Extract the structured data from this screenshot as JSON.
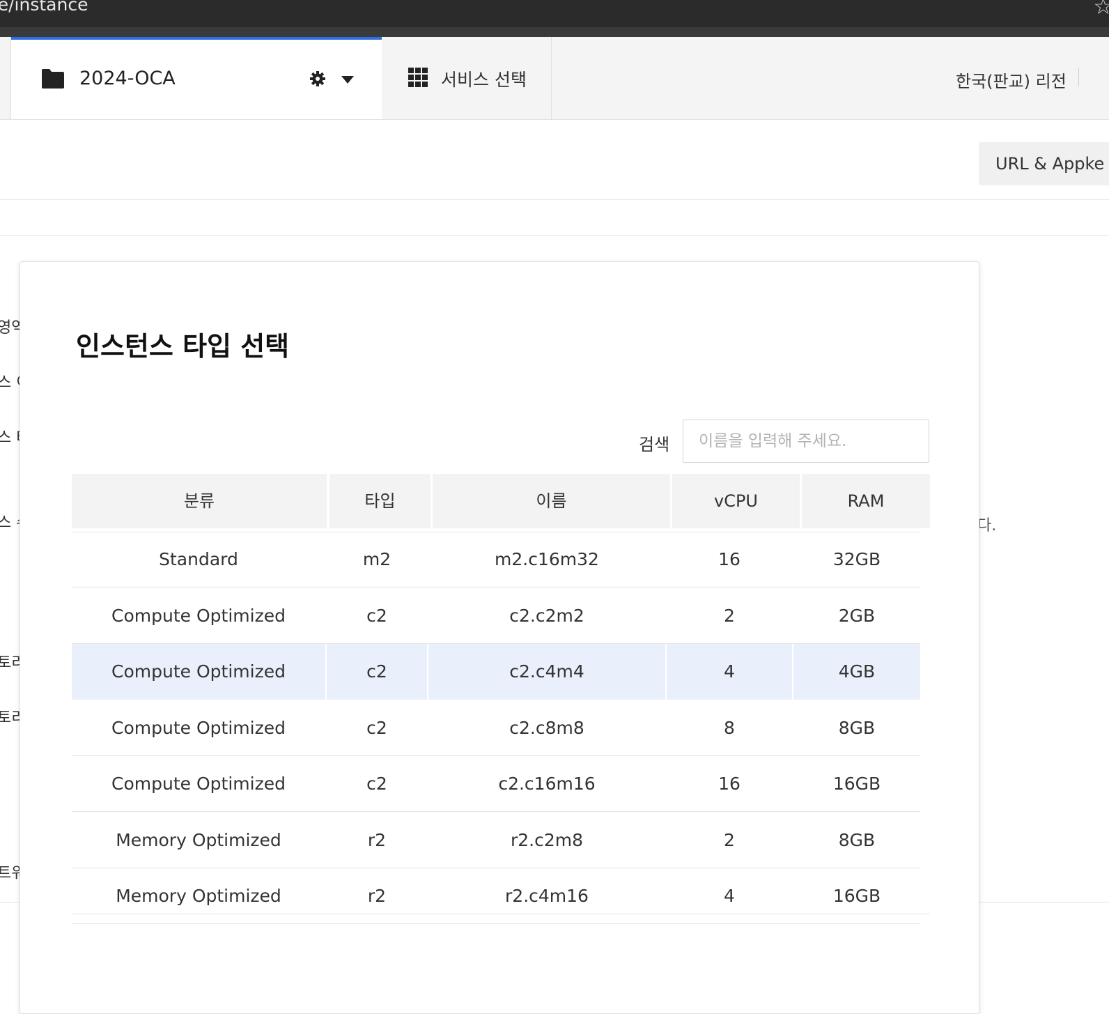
{
  "browser": {
    "url_fragment": "ite/instance"
  },
  "header": {
    "project_name": "2024-OCA",
    "service_select_label": "서비스 선택",
    "region_label": "한국(판교) 리전"
  },
  "toolbar": {
    "url_appkey_label": "URL & Appke"
  },
  "background": {
    "left_fragments": [
      "영역",
      "스 이",
      "스 타",
      "스 수",
      "토리",
      "토리",
      "트워"
    ],
    "right_fragment": "다."
  },
  "modal": {
    "title": "인스턴스 타입 선택",
    "search": {
      "label": "검색",
      "placeholder": "이름을 입력해 주세요."
    },
    "columns": [
      "분류",
      "타입",
      "이름",
      "vCPU",
      "RAM"
    ],
    "rows": [
      {
        "category": "Standard",
        "type": "m2",
        "name": "m2.c16m32",
        "vcpu": "16",
        "ram": "32GB"
      },
      {
        "category": "Compute Optimized",
        "type": "c2",
        "name": "c2.c2m2",
        "vcpu": "2",
        "ram": "2GB"
      },
      {
        "category": "Compute Optimized",
        "type": "c2",
        "name": "c2.c4m4",
        "vcpu": "4",
        "ram": "4GB",
        "selected": true
      },
      {
        "category": "Compute Optimized",
        "type": "c2",
        "name": "c2.c8m8",
        "vcpu": "8",
        "ram": "8GB"
      },
      {
        "category": "Compute Optimized",
        "type": "c2",
        "name": "c2.c16m16",
        "vcpu": "16",
        "ram": "16GB"
      },
      {
        "category": "Memory Optimized",
        "type": "r2",
        "name": "r2.c2m8",
        "vcpu": "2",
        "ram": "8GB"
      },
      {
        "category": "Memory Optimized",
        "type": "r2",
        "name": "r2.c4m16",
        "vcpu": "4",
        "ram": "16GB"
      }
    ]
  },
  "colors": {
    "accent": "#2f6fe4",
    "selected_row": "#e9f0fc",
    "header_bg": "#f3f3f3"
  }
}
